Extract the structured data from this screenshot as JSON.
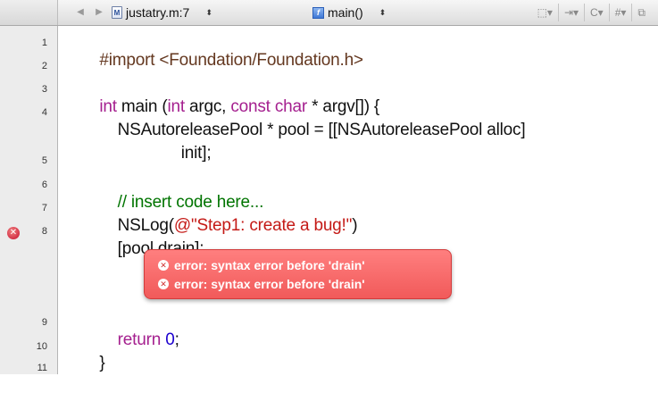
{
  "toolbar": {
    "back_icon": "back-arrow-icon",
    "forward_icon": "forward-arrow-icon",
    "file_label": "justatry.m:7",
    "file_icon_glyph": "M",
    "function_label": "main()",
    "function_icon_glyph": "f",
    "updown_glyph": "⬍",
    "tool_icons": [
      {
        "name": "bookmarks-menu-icon",
        "glyph": "⬚▾"
      },
      {
        "name": "breakpoints-menu-icon",
        "glyph": "⇥▾"
      },
      {
        "name": "class-menu-icon",
        "glyph": "C▾"
      },
      {
        "name": "includes-menu-icon",
        "glyph": "#▾"
      },
      {
        "name": "counterpart-icon",
        "glyph": "⧉"
      }
    ]
  },
  "line_numbers": [
    "1",
    "2",
    "3",
    "4",
    "5",
    "6",
    "7",
    "8",
    "9",
    "10",
    "11"
  ],
  "code": {
    "l1": "#import <Foundation/Foundation.h>",
    "l3_kw1": "int",
    "l3_a": " main (",
    "l3_kw2": "int",
    "l3_b": " argc, ",
    "l3_kw3": "const",
    "l3_c": " ",
    "l3_kw4": "char",
    "l3_d": " * argv[]) {",
    "l4": "    NSAutoreleasePool * pool = [[NSAutoreleasePool alloc]",
    "l4b": "                  init];",
    "l6": "    // insert code here...",
    "l7_a": "    NSLog(",
    "l7_str": "@\"Step1: create a bug!\"",
    "l7_b": ")",
    "l8": "    [pool drain];",
    "l9_kw": "return",
    "l9_num": "0",
    "l9_end": ";",
    "l10": "}"
  },
  "error_marker_glyph": "✕",
  "errors": [
    {
      "glyph": "✕",
      "text": "error: syntax error before 'drain'"
    },
    {
      "glyph": "✕",
      "text": "error: syntax error before 'drain'"
    }
  ]
}
